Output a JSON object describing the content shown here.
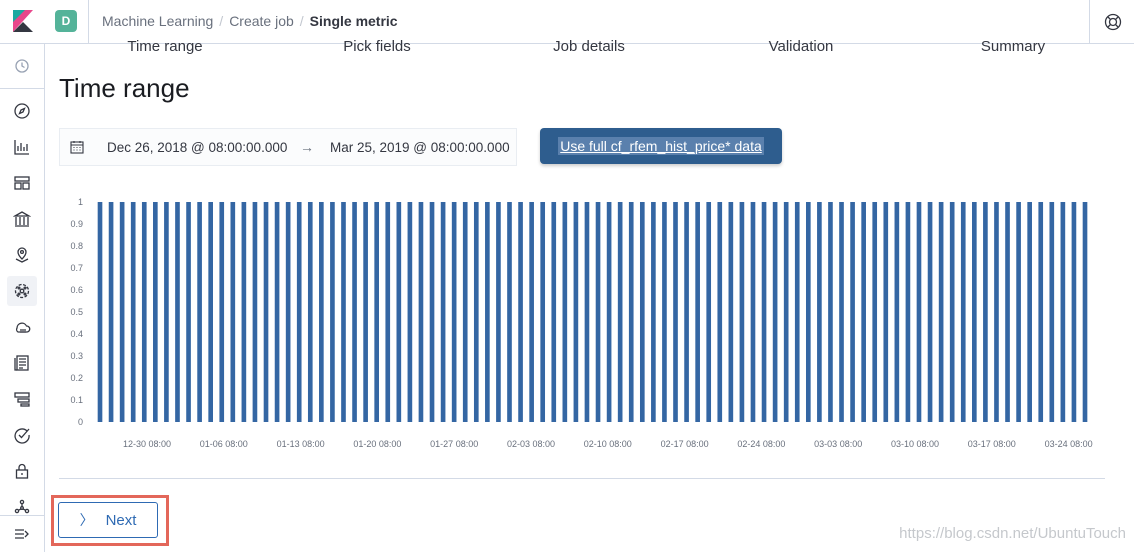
{
  "header": {
    "avatar_letter": "D",
    "breadcrumbs": [
      "Machine Learning",
      "Create job",
      "Single metric"
    ]
  },
  "steps": [
    "Time range",
    "Pick fields",
    "Job details",
    "Validation",
    "Summary"
  ],
  "page_title": "Time range",
  "date_range": {
    "start": "Dec 26, 2018 @ 08:00:00.000",
    "arrow": "→",
    "end": "Mar 25, 2019 @ 08:00:00.000"
  },
  "use_full_button_label": "Use full cf_rfem_hist_price* data",
  "chart_data": {
    "type": "bar",
    "ylim": [
      0,
      1
    ],
    "y_ticks": [
      "0",
      "0.1",
      "0.2",
      "0.3",
      "0.4",
      "0.5",
      "0.6",
      "0.7",
      "0.8",
      "0.9",
      "1"
    ],
    "x_tick_labels": [
      "12-30 08:00",
      "01-06 08:00",
      "01-13 08:00",
      "01-20 08:00",
      "01-27 08:00",
      "02-03 08:00",
      "02-10 08:00",
      "02-17 08:00",
      "02-24 08:00",
      "03-03 08:00",
      "03-10 08:00",
      "03-17 08:00",
      "03-24 08:00"
    ],
    "bar_count": 90,
    "value_per_bar": 1,
    "bar_color": "#3466a3",
    "grid": false
  },
  "next_button_label": "Next",
  "watermark": "https://blog.csdn.net/UbuntuTouch",
  "colors": {
    "accent": "#2e6ab3",
    "primary_button": "#2e5d8e",
    "highlight_box": "#e3675a"
  }
}
